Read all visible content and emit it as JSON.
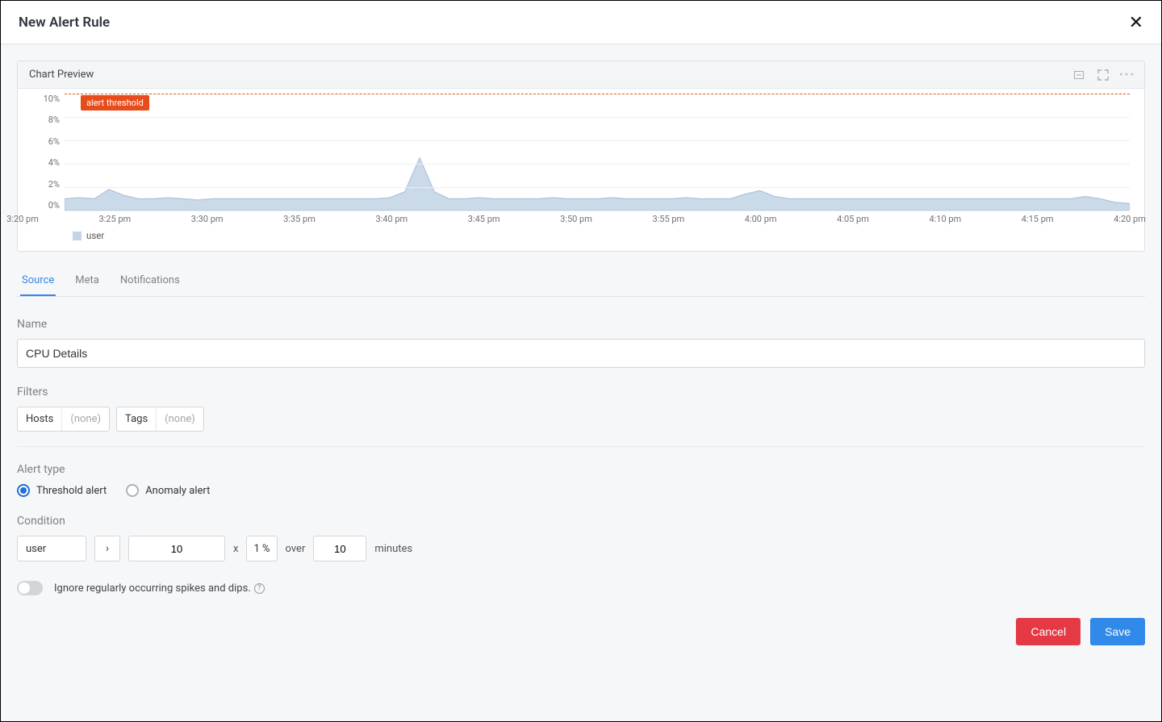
{
  "header": {
    "title": "New Alert Rule"
  },
  "chartPanel": {
    "title": "Chart Preview",
    "thresholdLabel": "alert threshold"
  },
  "chart_data": {
    "type": "area",
    "title": "",
    "series_name": "user",
    "ylabel": "",
    "ylim": [
      0,
      10
    ],
    "y_ticks": [
      "10%",
      "8%",
      "6%",
      "4%",
      "2%",
      "0%"
    ],
    "threshold_value": 10,
    "x_ticks": [
      "3:20 pm",
      "3:25 pm",
      "3:30 pm",
      "3:35 pm",
      "3:40 pm",
      "3:45 pm",
      "3:50 pm",
      "3:55 pm",
      "4:00 pm",
      "4:05 pm",
      "4:10 pm",
      "4:15 pm",
      "4:20 pm"
    ],
    "values": [
      1.0,
      1.1,
      1.0,
      1.8,
      1.3,
      1.0,
      1.0,
      1.1,
      1.0,
      0.9,
      1.0,
      1.0,
      1.0,
      1.0,
      1.0,
      1.0,
      1.0,
      1.0,
      1.0,
      1.0,
      1.0,
      1.0,
      1.1,
      1.6,
      4.5,
      1.6,
      1.0,
      1.0,
      1.1,
      1.0,
      1.0,
      1.0,
      1.0,
      1.1,
      1.0,
      1.0,
      1.0,
      1.1,
      1.0,
      1.0,
      1.0,
      1.0,
      1.1,
      1.0,
      1.0,
      1.0,
      1.4,
      1.7,
      1.2,
      1.0,
      1.0,
      1.0,
      1.0,
      1.0,
      1.0,
      1.0,
      1.0,
      1.0,
      1.0,
      1.0,
      1.0,
      1.0,
      1.0,
      1.0,
      1.0,
      1.0,
      1.0,
      1.0,
      1.0,
      1.2,
      1.0,
      0.7,
      0.6
    ]
  },
  "tabs": {
    "items": [
      "Source",
      "Meta",
      "Notifications"
    ],
    "active": 0
  },
  "form": {
    "nameLabel": "Name",
    "nameValue": "CPU Details",
    "filtersLabel": "Filters",
    "hostsLabel": "Hosts",
    "hostsValue": "(none)",
    "tagsLabel": "Tags",
    "tagsValue": "(none)",
    "alertTypeLabel": "Alert type",
    "radioThreshold": "Threshold alert",
    "radioAnomaly": "Anomaly alert",
    "conditionLabel": "Condition",
    "condMetric": "user",
    "condOperator": "›",
    "condValue": "10",
    "condX": "x",
    "condUnit": "1 %",
    "condOver": "over",
    "condMinutes": "10",
    "condMinutesLabel": "minutes",
    "ignoreLabel": "Ignore regularly occurring spikes and dips.",
    "helpGlyph": "?"
  },
  "buttons": {
    "cancel": "Cancel",
    "save": "Save"
  }
}
